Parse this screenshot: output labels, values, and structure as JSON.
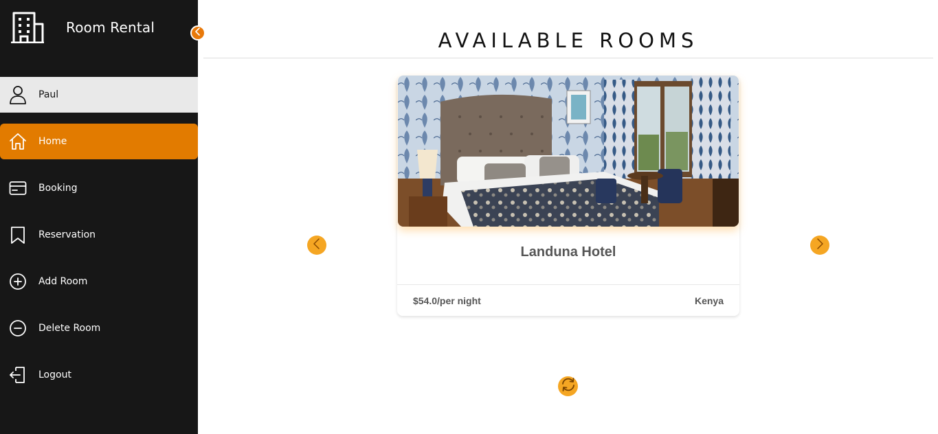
{
  "app": {
    "title": "Room Rental"
  },
  "sidebar": {
    "user": {
      "name": "Paul",
      "icon": "user-icon"
    },
    "items": [
      {
        "label": "Home",
        "icon": "home-icon",
        "active": true
      },
      {
        "label": "Booking",
        "icon": "credit-card-icon",
        "active": false
      },
      {
        "label": "Reservation",
        "icon": "bookmark-icon",
        "active": false
      },
      {
        "label": "Add Room",
        "icon": "plus-circle-icon",
        "active": false
      },
      {
        "label": "Delete Room",
        "icon": "minus-circle-icon",
        "active": false
      },
      {
        "label": "Logout",
        "icon": "logout-icon",
        "active": false
      }
    ]
  },
  "main": {
    "title": "AVAILABLE ROOMS",
    "room": {
      "name": "Landuna Hotel",
      "price": "$54.0/per night",
      "location": "Kenya"
    }
  },
  "colors": {
    "sidebar_bg": "#171717",
    "accent": "#e27b00",
    "button_accent": "#f5a623"
  }
}
